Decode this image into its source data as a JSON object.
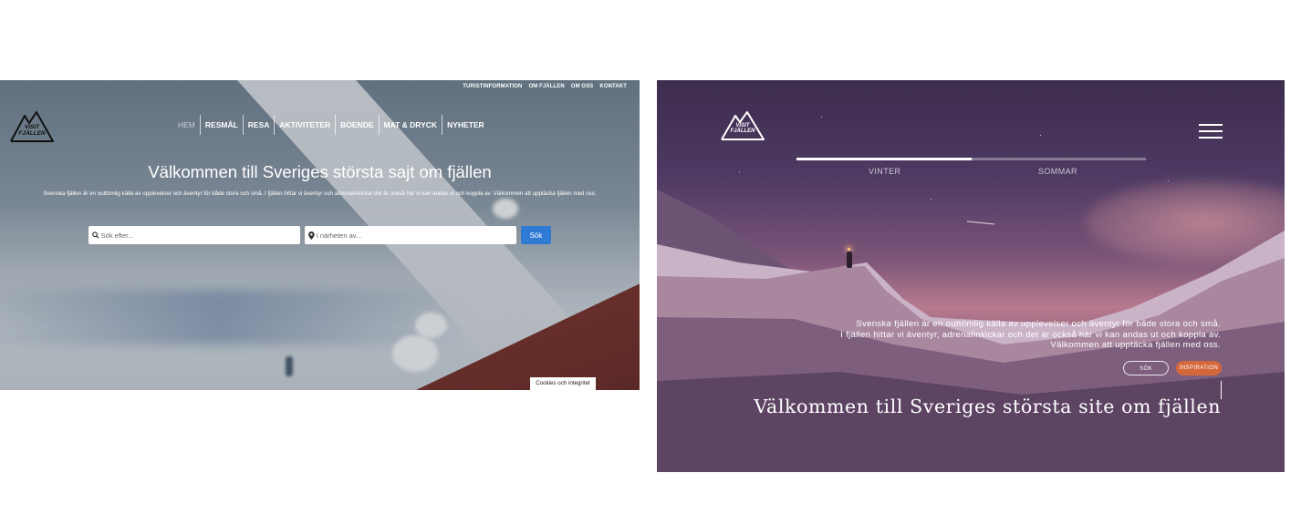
{
  "left": {
    "top_nav": [
      "TURISTINFORMATION",
      "OM FJÄLLEN",
      "OM OSS",
      "KONTAKT"
    ],
    "logo": {
      "line1": "VISIT",
      "line2": "FJÄLLEN"
    },
    "main_nav": [
      {
        "label": "HEM",
        "active": true
      },
      {
        "label": "RESMÅL",
        "active": false
      },
      {
        "label": "RESA",
        "active": false
      },
      {
        "label": "AKTIVITETER",
        "active": false
      },
      {
        "label": "BOENDE",
        "active": false
      },
      {
        "label": "MAT & DRYCK",
        "active": false
      },
      {
        "label": "NYHETER",
        "active": false
      }
    ],
    "hero": {
      "title": "Välkommen till Sveriges största sajt om fjällen",
      "subtitle": "Svenska fjällen är en outtömlig källa av upplevelser och äventyr för både stora och små. I fjällen hittar vi äventyr och adrenalinkickar det är också här vi kan andas ut och koppla av. Välkommen att upptäcka fjällen med oss."
    },
    "search": {
      "query_placeholder": "Sök efter...",
      "near_placeholder": "I närheten av...",
      "button_label": "Sök"
    },
    "cookie_label": "Cookies och integritet",
    "colors": {
      "search_button": "#2f7ad3"
    }
  },
  "right": {
    "logo": {
      "line1": "VISIT",
      "line2": "FJÄLLEN"
    },
    "seasons": [
      {
        "label": "VINTER",
        "active": true
      },
      {
        "label": "SOMMAR",
        "active": false
      }
    ],
    "season_progress": 0.5,
    "subtitle_lines": [
      "Svenska fjällen är en outtömlig källa av upplevelser och äventyr för både stora och små.",
      "I fjällen hittar vi äventyr, adrenalinkickar och det är också här vi kan andas ut och koppla av.",
      "Välkommen att upptäcka fjällen med oss."
    ],
    "buttons": {
      "search": "SÖK",
      "inspiration": "INSPIRATION"
    },
    "title": "Välkommen till Sveriges största site om fjällen",
    "colors": {
      "inspiration_button": "#d5683a"
    }
  }
}
